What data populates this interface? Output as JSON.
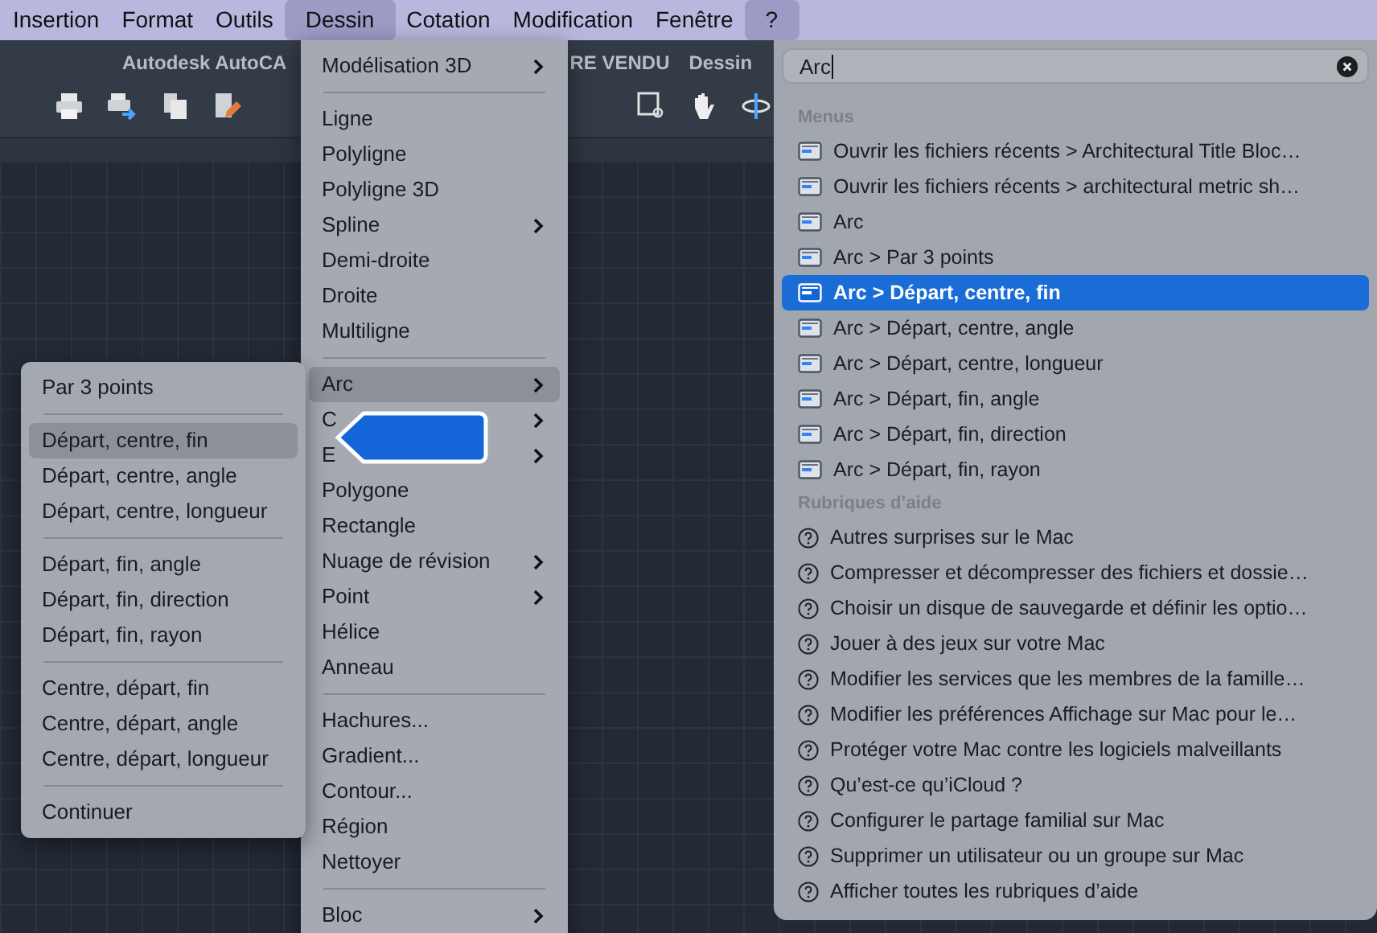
{
  "menu_bar": [
    {
      "label": "Insertion",
      "selected": false
    },
    {
      "label": "Format",
      "selected": false
    },
    {
      "label": "Outils",
      "selected": false
    },
    {
      "label": "Dessin",
      "selected": true
    },
    {
      "label": "Cotation",
      "selected": false
    },
    {
      "label": "Modification",
      "selected": false
    },
    {
      "label": "Fenêtre",
      "selected": false
    },
    {
      "label": "?",
      "selected": true
    }
  ],
  "app_title": [
    "Autodesk AutoCA",
    "RE VENDU",
    "Dessin"
  ],
  "dessin_menu": {
    "groups": [
      [
        {
          "label": "Modélisation 3D",
          "submenu": true,
          "selected": false
        }
      ],
      [
        {
          "label": "Ligne",
          "submenu": false,
          "selected": false
        },
        {
          "label": "Polyligne",
          "submenu": false,
          "selected": false
        },
        {
          "label": "Polyligne 3D",
          "submenu": false,
          "selected": false
        },
        {
          "label": "Spline",
          "submenu": true,
          "selected": false
        },
        {
          "label": "Demi-droite",
          "submenu": false,
          "selected": false
        },
        {
          "label": "Droite",
          "submenu": false,
          "selected": false
        },
        {
          "label": "Multiligne",
          "submenu": false,
          "selected": false
        }
      ],
      [
        {
          "label": "Arc",
          "submenu": true,
          "selected": true
        },
        {
          "label": "C",
          "submenu": true,
          "selected": false
        },
        {
          "label": "E",
          "submenu": true,
          "selected": false
        },
        {
          "label": "Polygone",
          "submenu": false,
          "selected": false
        },
        {
          "label": "Rectangle",
          "submenu": false,
          "selected": false
        },
        {
          "label": "Nuage de révision",
          "submenu": true,
          "selected": false
        },
        {
          "label": "Point",
          "submenu": true,
          "selected": false
        },
        {
          "label": "Hélice",
          "submenu": false,
          "selected": false
        },
        {
          "label": "Anneau",
          "submenu": false,
          "selected": false
        }
      ],
      [
        {
          "label": "Hachures...",
          "submenu": false,
          "selected": false
        },
        {
          "label": "Gradient...",
          "submenu": false,
          "selected": false
        },
        {
          "label": "Contour...",
          "submenu": false,
          "selected": false
        },
        {
          "label": "Région",
          "submenu": false,
          "selected": false
        },
        {
          "label": "Nettoyer",
          "submenu": false,
          "selected": false
        }
      ],
      [
        {
          "label": "Bloc",
          "submenu": true,
          "selected": false
        }
      ]
    ]
  },
  "arc_submenu": {
    "groups": [
      [
        {
          "label": "Par 3 points",
          "selected": false
        }
      ],
      [
        {
          "label": "Départ, centre, fin",
          "selected": true
        },
        {
          "label": "Départ, centre, angle",
          "selected": false
        },
        {
          "label": "Départ, centre, longueur",
          "selected": false
        }
      ],
      [
        {
          "label": "Départ, fin, angle",
          "selected": false
        },
        {
          "label": "Départ, fin, direction",
          "selected": false
        },
        {
          "label": "Départ, fin, rayon",
          "selected": false
        }
      ],
      [
        {
          "label": "Centre, départ, fin",
          "selected": false
        },
        {
          "label": "Centre, départ, angle",
          "selected": false
        },
        {
          "label": "Centre, départ, longueur",
          "selected": false
        }
      ],
      [
        {
          "label": "Continuer",
          "selected": false
        }
      ]
    ]
  },
  "help_panel": {
    "search": {
      "value": "Arc"
    },
    "sections": [
      {
        "heading": "Menus",
        "kind": "menu",
        "items": [
          {
            "label": "Ouvrir les fichiers récents > Architectural Title Bloc…",
            "selected": false
          },
          {
            "label": "Ouvrir les fichiers récents > architectural metric sh…",
            "selected": false
          },
          {
            "label": "Arc",
            "selected": false
          },
          {
            "label": "Arc > Par 3 points",
            "selected": false
          },
          {
            "label": "Arc > Départ, centre, fin",
            "selected": true
          },
          {
            "label": "Arc > Départ, centre, angle",
            "selected": false
          },
          {
            "label": "Arc > Départ, centre, longueur",
            "selected": false
          },
          {
            "label": "Arc > Départ, fin, angle",
            "selected": false
          },
          {
            "label": "Arc > Départ, fin, direction",
            "selected": false
          },
          {
            "label": "Arc > Départ, fin, rayon",
            "selected": false
          }
        ]
      },
      {
        "heading": "Rubriques d’aide",
        "kind": "help",
        "items": [
          {
            "label": "Autres surprises sur le Mac",
            "selected": false
          },
          {
            "label": "Compresser et décompresser des fichiers et dossie…",
            "selected": false
          },
          {
            "label": "Choisir un disque de sauvegarde et définir les optio…",
            "selected": false
          },
          {
            "label": "Jouer à des jeux sur votre Mac",
            "selected": false
          },
          {
            "label": "Modifier les services que les membres de la famille…",
            "selected": false
          },
          {
            "label": "Modifier les préférences Affichage sur Mac pour le…",
            "selected": false
          },
          {
            "label": "Protéger votre Mac contre les logiciels malveillants",
            "selected": false
          },
          {
            "label": "Qu’est-ce qu’iCloud ?",
            "selected": false
          },
          {
            "label": "Configurer le partage familial sur Mac",
            "selected": false
          },
          {
            "label": "Supprimer un utilisateur ou un groupe sur Mac",
            "selected": false
          },
          {
            "label": "Afficher toutes les rubriques d’aide",
            "selected": false
          }
        ]
      }
    ]
  }
}
